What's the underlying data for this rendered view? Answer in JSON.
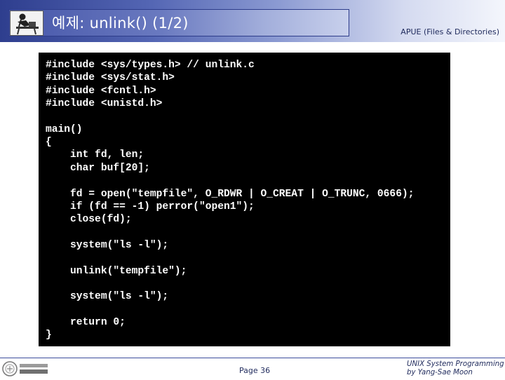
{
  "header": {
    "title": "예제: unlink() (1/2)",
    "subtitle": "APUE (Files & Directories)",
    "icon": "person-at-desk-icon"
  },
  "code": {
    "lines": [
      "#include <sys/types.h> // unlink.c",
      "#include <sys/stat.h>",
      "#include <fcntl.h>",
      "#include <unistd.h>",
      "",
      "main()",
      "{",
      "    int fd, len;",
      "    char buf[20];",
      "",
      "    fd = open(\"tempfile\", O_RDWR | O_CREAT | O_TRUNC, 0666);",
      "    if (fd == -1) perror(\"open1\");",
      "    close(fd);",
      "",
      "    system(\"ls -l\");",
      "",
      "    unlink(\"tempfile\");",
      "",
      "    system(\"ls -l\");",
      "",
      "    return 0;",
      "}"
    ]
  },
  "footer": {
    "page": "Page 36",
    "credit_line1": "UNIX System Programming",
    "credit_line2": "by Yang-Sae Moon",
    "logo_icon": "university-seal-icon"
  },
  "colors": {
    "header_dark": "#2e3e8e",
    "code_bg": "#000000",
    "code_fg": "#ffffff",
    "footer_text": "#1f2a5c"
  }
}
